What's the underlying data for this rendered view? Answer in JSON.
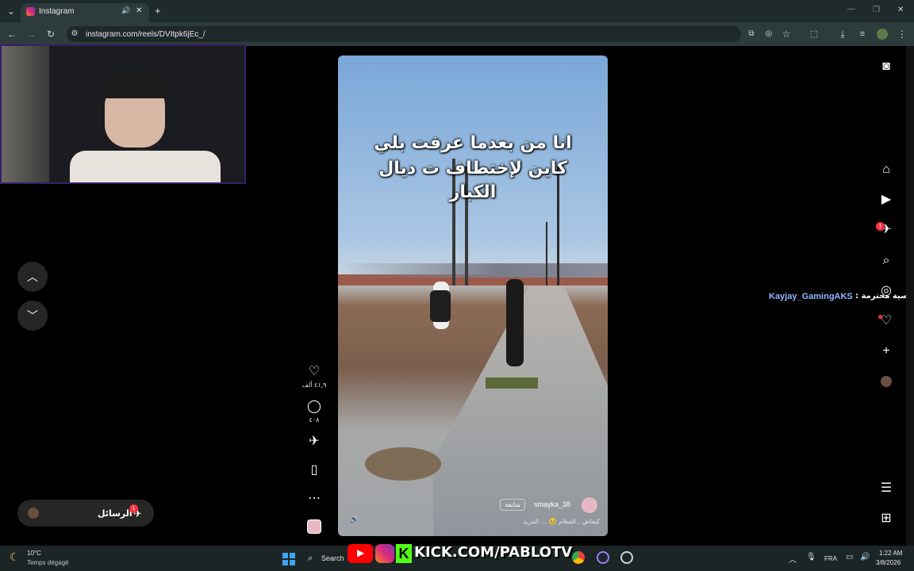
{
  "browser": {
    "tab_title": "Instagram",
    "url": "instagram.com/reels/DVItpk6jEc_/",
    "new_tab_symbol": "+",
    "tab_close_symbol": "✕"
  },
  "reel": {
    "caption_line1": "انا من بعدما عرفت بلي",
    "caption_line2": "كاين لإختطاف ت ديال",
    "caption_line3": "الكبار",
    "likes": "٤١,٩ ألف",
    "comments": "٤٠٨",
    "username": "smayka_38",
    "follow_label": "متابعة",
    "audio_text": "كيفاش , السلام 🥹 ... المزيد"
  },
  "chat_overlay": {
    "username": "Kayjay_GamingAKS",
    "message": ": شخصية محترمة"
  },
  "messages_bar": {
    "label": "الرسائل",
    "badge": "1"
  },
  "notifications_badge": "1",
  "stream_banner": "KICK.COM/PABLOTV",
  "taskbar": {
    "weather_temp": "10°C",
    "weather_desc": "Temps dégagé",
    "search_label": "Search",
    "language": "FRA",
    "time": "1:22 AM",
    "date": "3/8/2026"
  }
}
